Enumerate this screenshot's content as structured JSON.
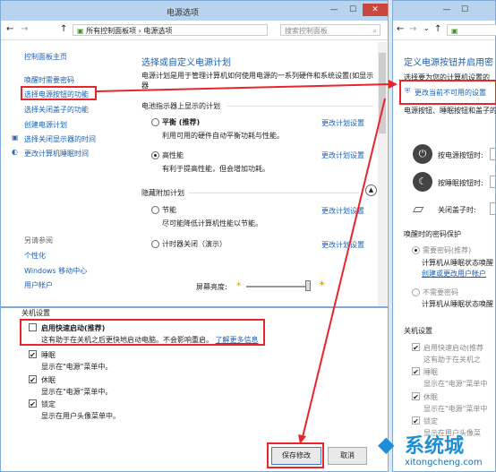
{
  "window_main": {
    "title": "电源选项",
    "breadcrumb": [
      "所有控制面板项",
      "电源选项"
    ],
    "search_placeholder": "搜索控制面板",
    "sidebar": {
      "home": "控制面板主页",
      "items": [
        "唤醒时需要密码",
        "选择电源按钮的功能",
        "选择关闭盖子的功能",
        "创建电源计划",
        "选择关闭显示器的时间",
        "更改计算机睡眠时间"
      ],
      "see_also_title": "另请参阅",
      "see_also": [
        "个性化",
        "Windows 移动中心",
        "用户帐户"
      ]
    },
    "main": {
      "title": "选择或自定义电源计划",
      "desc": "电源计划是用于管理计算机如何使用电源的一系列硬件和系统设置(如显示器",
      "section_bar": "电池指示器上显示的计划",
      "plans": [
        {
          "name": "平衡 (推荐)",
          "desc": "利用可用的硬件自动平衡功耗与性能。",
          "link": "更改计划设置",
          "selected": false
        },
        {
          "name": "高性能",
          "desc": "有利于提高性能，但会增加功耗。",
          "link": "更改计划设置",
          "selected": true
        }
      ],
      "hidden_title": "隐藏附加计划",
      "hidden_plans": [
        {
          "name": "节能",
          "desc": "尽可能降低计算机性能以节能。",
          "link": "更改计划设置"
        },
        {
          "name": "计时器关闭（演示）",
          "desc": "",
          "link": "更改计划设置"
        }
      ],
      "brightness_label": "屏幕亮度:"
    }
  },
  "shutdown_panel": {
    "title": "关机设置",
    "items": [
      {
        "label": "启用快速启动(推荐)",
        "desc": "这有助于在关机之后更快地启动电脑。不会影响重启。",
        "link": "了解更多信息",
        "checked": false
      },
      {
        "label": "睡眠",
        "desc": "显示在\"电源\"菜单中。",
        "checked": true
      },
      {
        "label": "休眠",
        "desc": "显示在\"电源\"菜单中。",
        "checked": true
      },
      {
        "label": "锁定",
        "desc": "显示在用户头像菜单中。",
        "checked": true
      }
    ],
    "save_button": "保存修改",
    "cancel_button": "取消"
  },
  "window_right": {
    "heading": "定义电源按钮并启用密",
    "subtext": "选择要为您的计算机设置的",
    "change_link": "更改当前不可用的设置",
    "section": "电源按钮、睡眠按钮和盖子的",
    "rows": [
      "按电源按钮时:",
      "按睡眠按钮时:",
      "关闭盖子时:"
    ],
    "password_title": "唤醒时的密码保护",
    "pw_opt1": "需要密码(推荐)",
    "pw_opt1_desc1": "计算机从睡眠状态唤醒",
    "pw_opt1_link": "创建或更改用户帐户",
    "pw_opt2": "不需要密码",
    "pw_opt2_desc": "计算机从睡眠状态唤醒",
    "shutdown_title": "关机设置",
    "shutdown_items": [
      {
        "label": "启用快速启动(推荐",
        "desc": "这有助于在关机之"
      },
      {
        "label": "睡眠",
        "desc": "显示在\"电源\"菜单中"
      },
      {
        "label": "休眠",
        "desc": "显示在\"电源\"菜单中"
      },
      {
        "label": "锁定",
        "desc": "显示在用户头像菜"
      }
    ]
  },
  "watermark": {
    "brand": "系统城",
    "url": "xitongcheng.com"
  },
  "colors": {
    "highlight": "#e8262a",
    "link": "#1a5fb4",
    "titlebar": "#b8d3ee"
  }
}
